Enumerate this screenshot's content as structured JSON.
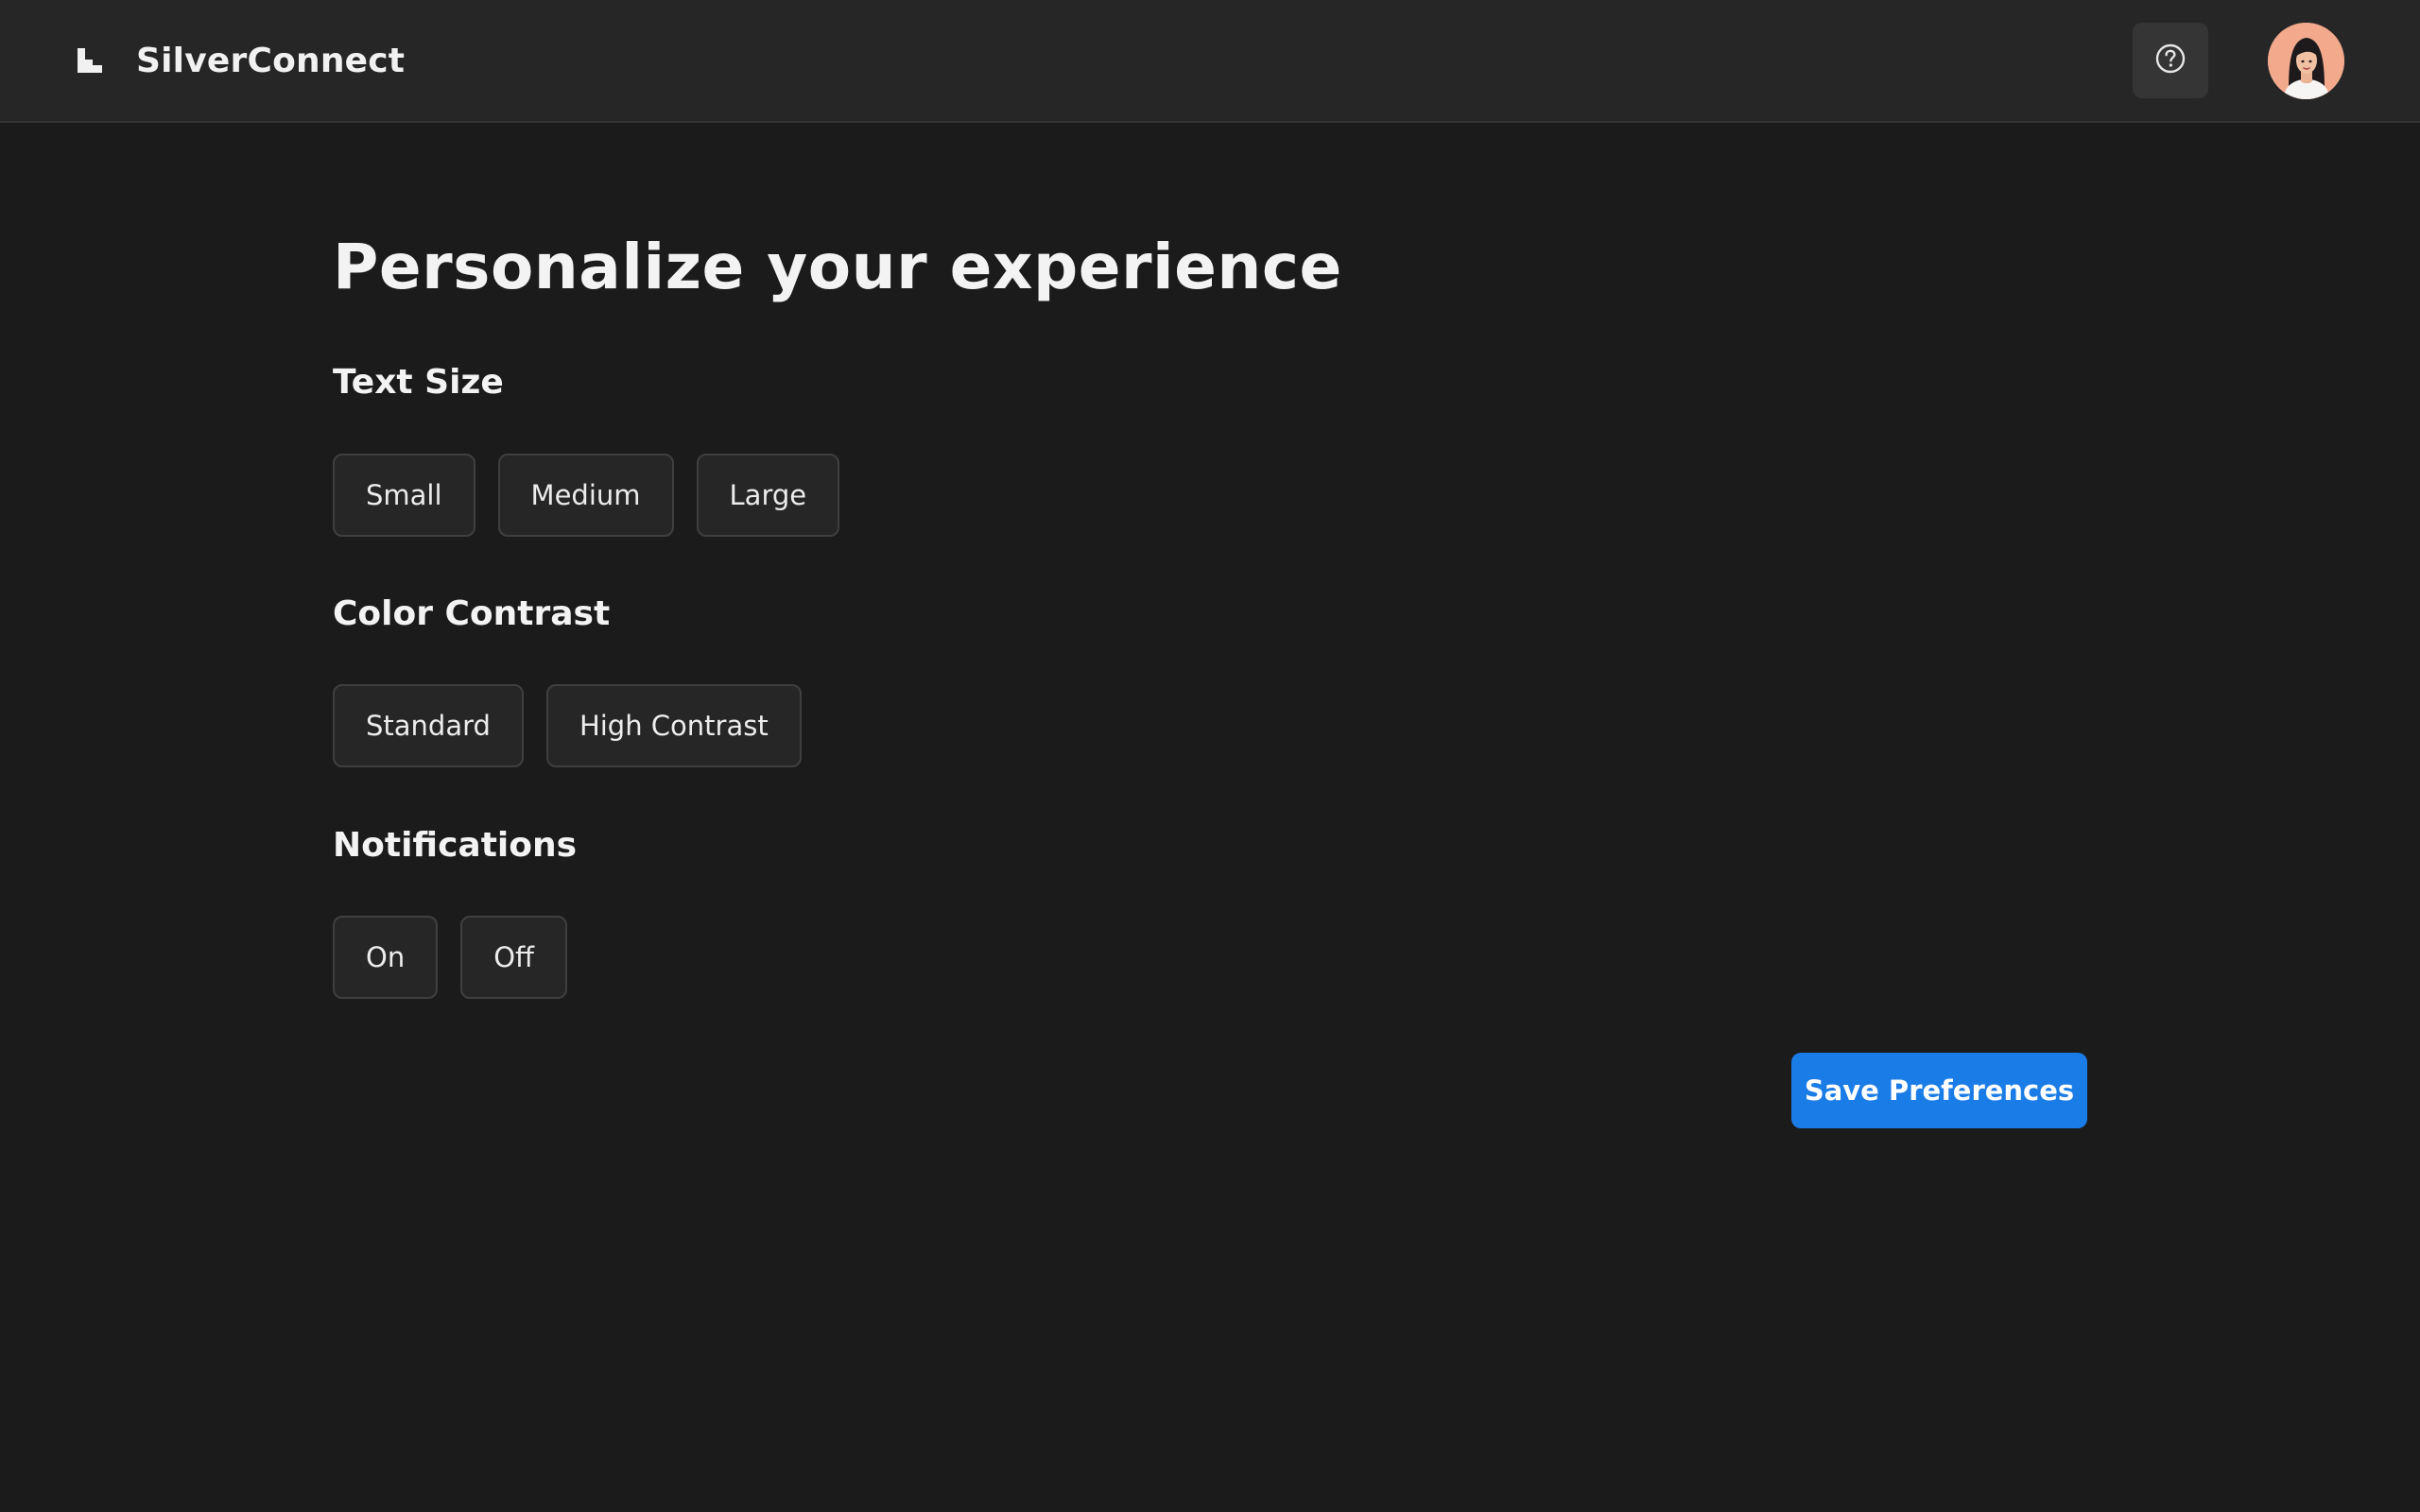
{
  "header": {
    "brand_name": "SilverConnect",
    "logo_icon": "steps-logo-icon",
    "help_icon": "question-circle-icon",
    "avatar_icon": "user-avatar"
  },
  "main": {
    "title": "Personalize your experience",
    "sections": [
      {
        "title": "Text Size",
        "options": [
          "Small",
          "Medium",
          "Large"
        ]
      },
      {
        "title": "Color Contrast",
        "options": [
          "Standard",
          "High Contrast"
        ]
      },
      {
        "title": "Notifications",
        "options": [
          "On",
          "Off"
        ]
      }
    ],
    "save_label": "Save Preferences"
  },
  "colors": {
    "background": "#1b1b1c",
    "header_background": "#262627",
    "option_background": "#262627",
    "option_border": "#3f3f41",
    "accent": "#1a7ce6",
    "avatar_background": "#f2a98c"
  }
}
